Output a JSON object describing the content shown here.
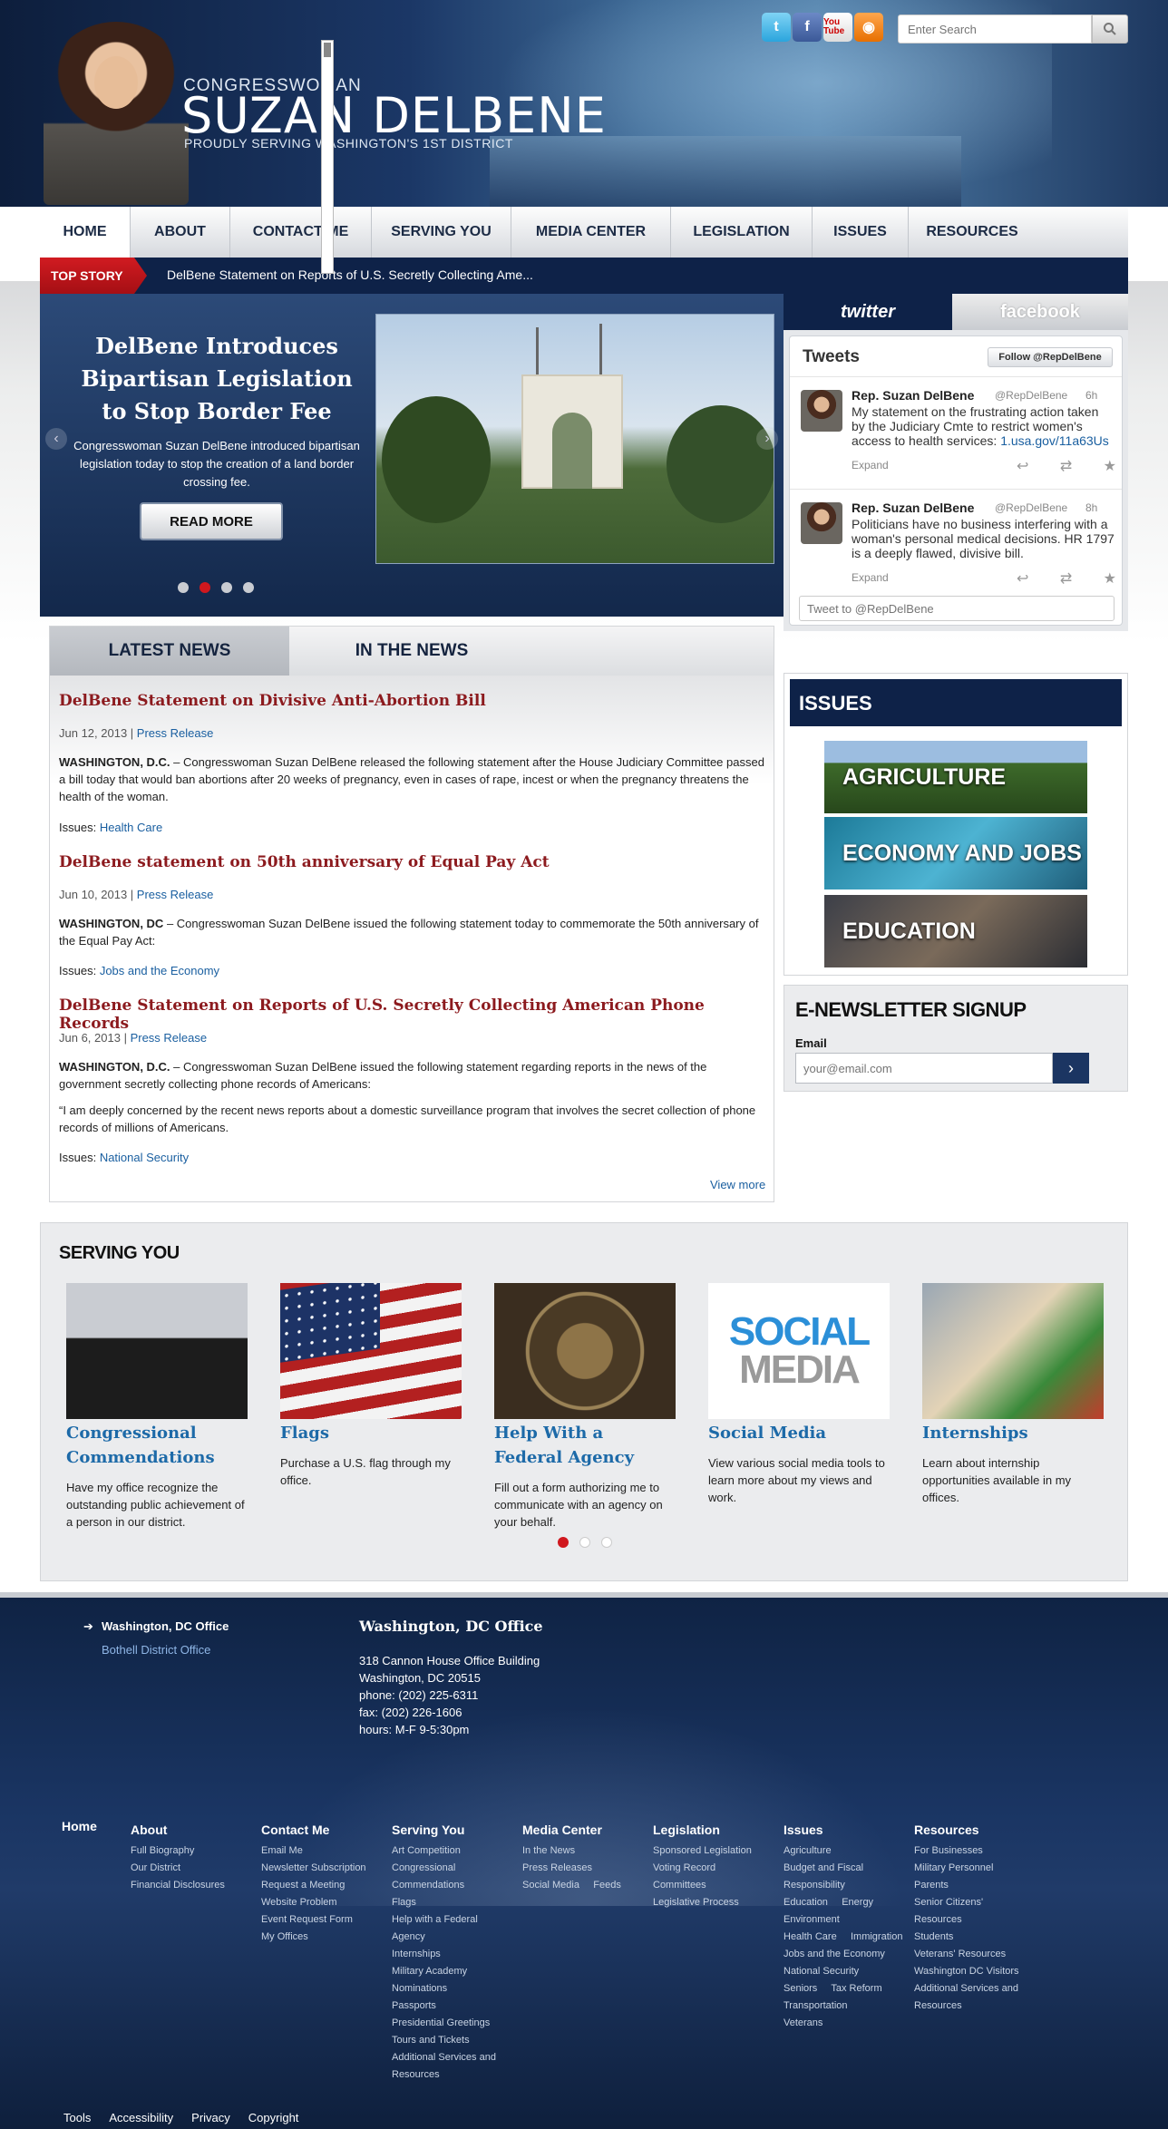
{
  "header": {
    "title_pre": "CONGRESSWOMAN",
    "title_main": "SUZAN DELBENE",
    "title_sub": "PROUDLY SERVING WASHINGTON'S 1ST DISTRICT",
    "search_placeholder": "Enter Search",
    "social": [
      {
        "name": "twitter-icon",
        "label": "t"
      },
      {
        "name": "facebook-icon",
        "label": "f"
      },
      {
        "name": "youtube-icon",
        "label": "You Tube"
      },
      {
        "name": "rss-icon",
        "label": "◉"
      }
    ]
  },
  "nav": {
    "items": [
      "HOME",
      "ABOUT",
      "CONTACT ME",
      "SERVING YOU",
      "MEDIA CENTER",
      "LEGISLATION",
      "ISSUES",
      "RESOURCES"
    ],
    "active": "HOME"
  },
  "top_story": {
    "label": "TOP STORY",
    "text": "DelBene Statement on Reports of U.S. Secretly Collecting Ame..."
  },
  "slider": {
    "title": "DelBene Introduces Bipartisan Legislation to Stop Border Fee",
    "text": "Congresswoman Suzan DelBene introduced bipartisan legislation today to stop the creation of a land border crossing fee.",
    "button": "READ MORE",
    "dots": 4,
    "active_dot": 2
  },
  "social_tabs": {
    "twitter_label": "twitter",
    "facebook_label": "facebook",
    "tweets_title": "Tweets",
    "follow_label": "Follow @RepDelBene",
    "tweets": [
      {
        "name": "Rep. Suzan DelBene",
        "handle": "@RepDelBene",
        "time": "6h",
        "text": "My statement on the frustrating action taken by the Judiciary Cmte to restrict women's access to health services:",
        "link": "1.usa.gov/11a63Us",
        "expand": "Expand"
      },
      {
        "name": "Rep. Suzan DelBene",
        "handle": "@RepDelBene",
        "time": "8h",
        "text": "Politicians have no business interfering with a woman's personal medical decisions. HR 1797 is a deeply flawed, divisive bill.",
        "link": "",
        "expand": "Expand"
      }
    ],
    "tweet_placeholder": "Tweet to @RepDelBene"
  },
  "news": {
    "tabs": [
      "LATEST NEWS",
      "IN THE NEWS"
    ],
    "articles": [
      {
        "title": "DelBene Statement on Divisive Anti-Abortion Bill",
        "date": "Jun 12, 2013",
        "category": "Press Release",
        "lead": "WASHINGTON, D.C.",
        "body": " – Congresswoman Suzan DelBene released the following statement after the House Judiciary Committee passed a bill today that would ban abortions after 20 weeks of pregnancy, even in cases of rape, incest or when the pregnancy threatens the health of the woman.",
        "issues_label": "Issues:",
        "issue": "Health Care"
      },
      {
        "title": "DelBene statement on 50th anniversary of Equal Pay Act",
        "date": "Jun 10, 2013",
        "category": "Press Release",
        "lead": "WASHINGTON, DC",
        "body": " – Congresswoman Suzan DelBene issued the following statement today to commemorate the 50th anniversary of the Equal Pay Act:",
        "issues_label": "Issues:",
        "issue": "Jobs and the Economy"
      },
      {
        "title": "DelBene Statement on Reports of U.S. Secretly Collecting American Phone Records",
        "date": "Jun 6, 2013",
        "category": "Press Release",
        "lead": "WASHINGTON, D.C.",
        "body": " – Congresswoman Suzan DelBene issued the following statement regarding reports in the news of the government secretly collecting phone records of Americans:",
        "quote": "“I am deeply concerned by the recent news reports about a domestic surveillance program that involves the secret collection of phone records of millions of Americans.",
        "issues_label": "Issues:",
        "issue": "National Security"
      }
    ],
    "view_more": "View more"
  },
  "issues": {
    "title": "ISSUES",
    "tiles": [
      "AGRICULTURE",
      "ECONOMY AND JOBS",
      "EDUCATION"
    ]
  },
  "newsletter": {
    "title": "E-NEWSLETTER SIGNUP",
    "email_label": "Email",
    "email_placeholder": "your@email.com",
    "submit": "›"
  },
  "serving": {
    "title": "SERVING YOU",
    "cards": [
      {
        "title": "Congressional Commendations",
        "text": "Have my office recognize the outstanding public achievement of a person in our district."
      },
      {
        "title": "Flags",
        "text": "Purchase a U.S. flag through my office."
      },
      {
        "title": "Help With a Federal Agency",
        "text": "Fill out a form authorizing me to communicate with an agency on your behalf."
      },
      {
        "title": "Social Media",
        "text": "View various social media tools to learn more about my views and work."
      },
      {
        "title": "Internships",
        "text": "Learn about internship opportunities available in my offices."
      }
    ],
    "social_img_line1": "SOCIAL",
    "social_img_line2": "MEDIA"
  },
  "footer": {
    "offices": [
      "Washington, DC Office",
      "Bothell District Office"
    ],
    "office_title": "Washington, DC Office",
    "office_lines": [
      "318 Cannon House Office Building",
      "Washington, DC 20515",
      "phone: (202) 225-6311",
      "fax: (202) 226-1606",
      "hours: M-F 9-5:30pm"
    ],
    "home": "Home",
    "columns": [
      {
        "title": "About",
        "links": [
          "Full Biography",
          "Our District",
          "Financial Disclosures"
        ]
      },
      {
        "title": "Contact Me",
        "links": [
          "Email Me",
          "Newsletter Subscription",
          "Request a Meeting",
          "Website Problem",
          "Event Request Form",
          "My Offices"
        ]
      },
      {
        "title": "Serving You",
        "links": [
          "Art Competition",
          "Congressional",
          "Commendations",
          "Flags",
          "Help with a Federal",
          "Agency",
          "Internships",
          "Military Academy",
          "Nominations",
          "Passports",
          "Presidential Greetings",
          "Tours and Tickets",
          "Additional Services and",
          "Resources"
        ]
      },
      {
        "title": "Media Center",
        "links": [
          "In the News",
          "Press Releases",
          "Social Media     Feeds"
        ]
      },
      {
        "title": "Legislation",
        "links": [
          "Sponsored Legislation",
          "Voting Record",
          "Committees",
          "Legislative Process"
        ]
      },
      {
        "title": "Issues",
        "links": [
          "Agriculture",
          "Budget and Fiscal",
          "Responsibility",
          "Education     Energy",
          "Environment",
          "Health Care     Immigration",
          "Jobs and the Economy",
          "National Security",
          "Seniors     Tax Reform",
          "Transportation",
          "Veterans"
        ]
      },
      {
        "title": "Resources",
        "links": [
          "For Businesses",
          "Military Personnel",
          "Parents",
          "Senior Citizens'",
          "Resources",
          "Students",
          "Veterans' Resources",
          "Washington DC Visitors",
          "Additional Services and",
          "Resources"
        ]
      }
    ],
    "bottom": [
      "Tools",
      "Accessibility",
      "Privacy",
      "Copyright"
    ]
  }
}
